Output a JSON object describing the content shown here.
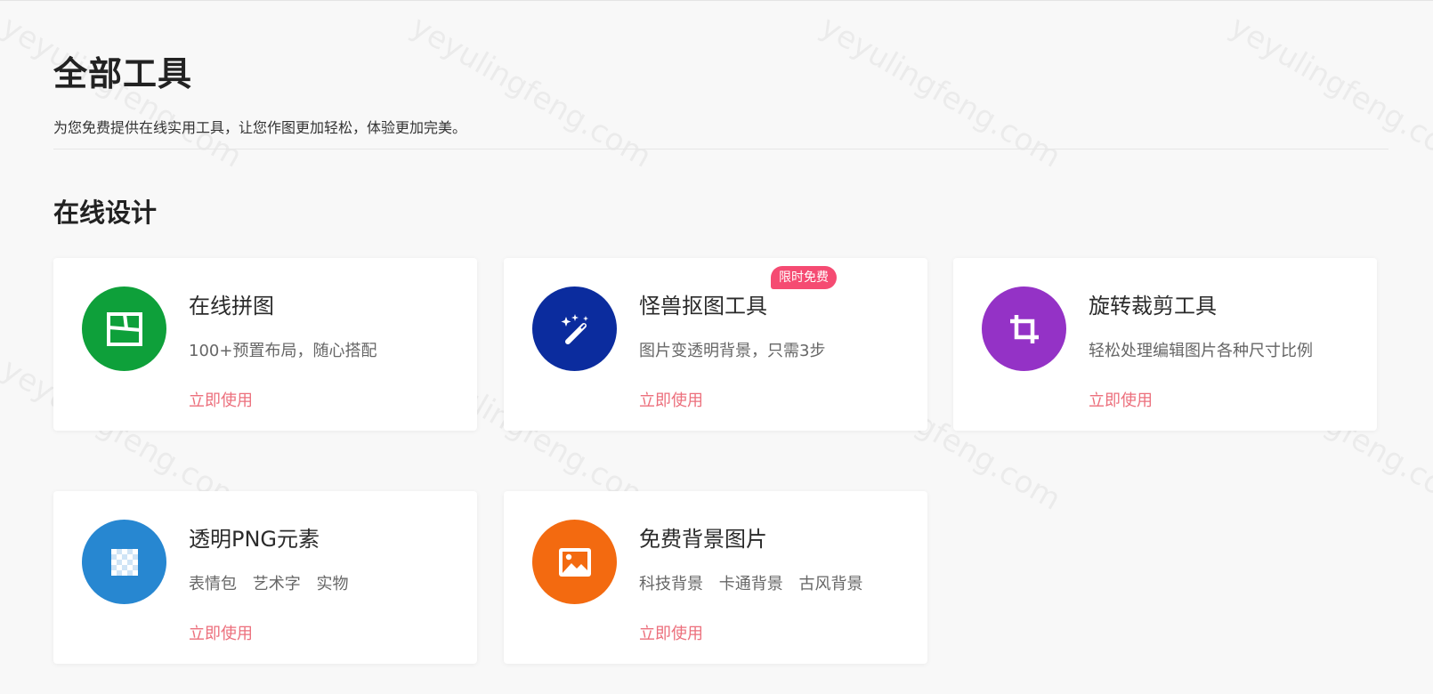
{
  "page": {
    "title": "全部工具",
    "subtitle": "为您免费提供在线实用工具，让您作图更加轻松，体验更加完美。",
    "section_title": "在线设计",
    "watermark": "yeyulingfeng.com"
  },
  "colors": {
    "green": "#0ea03a",
    "navy": "#0b2c9e",
    "purple": "#9432c6",
    "blue": "#2787d1",
    "orange": "#f36a10",
    "link": "#ec6f7c",
    "badge": "#f54b72"
  },
  "cards": [
    {
      "title": "在线拼图",
      "desc": "100+预置布局，随心搭配",
      "link": "立即使用",
      "icon": "collage-layout-icon"
    },
    {
      "title": "怪兽抠图工具",
      "desc": "图片变透明背景，只需3步",
      "link": "立即使用",
      "badge": "限时免费",
      "icon": "magic-wand-icon"
    },
    {
      "title": "旋转裁剪工具",
      "desc": "轻松处理编辑图片各种尺寸比例",
      "link": "立即使用",
      "icon": "crop-icon"
    },
    {
      "title": "透明PNG元素",
      "desc_parts": [
        "表情包",
        "艺术字",
        "实物"
      ],
      "link": "立即使用",
      "icon": "transparent-grid-icon"
    },
    {
      "title": "免费背景图片",
      "desc_parts": [
        "科技背景",
        "卡通背景",
        "古风背景"
      ],
      "link": "立即使用",
      "icon": "image-icon"
    }
  ]
}
